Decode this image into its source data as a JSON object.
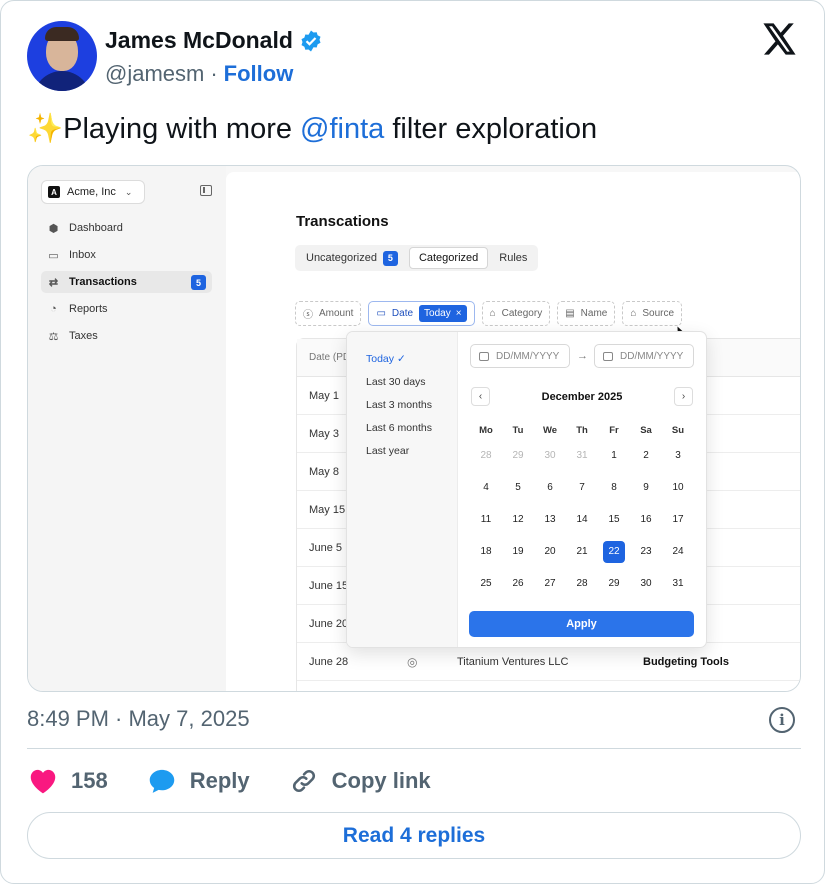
{
  "author": {
    "name": "James McDonald",
    "handle": "@jamesm",
    "separator": "·",
    "follow_label": "Follow"
  },
  "tweet": {
    "emoji": "✨",
    "text_before": "Playing with more ",
    "mention": "@finta",
    "text_after": " filter exploration"
  },
  "app": {
    "org_badge": "A",
    "org_name": "Acme, Inc",
    "nav": [
      {
        "icon": "⬢",
        "label": "Dashboard"
      },
      {
        "icon": "▭",
        "label": "Inbox"
      },
      {
        "icon": "⇄",
        "label": "Transactions",
        "badge": "5"
      },
      {
        "icon": "◔",
        "label": "Reports"
      },
      {
        "icon": "⚖",
        "label": "Taxes"
      }
    ],
    "page_title": "Transcations",
    "tabs": [
      {
        "label": "Uncategorized",
        "badge": "5"
      },
      {
        "label": "Categorized"
      },
      {
        "label": "Rules"
      }
    ],
    "filters": {
      "amount": "Amount",
      "date": "Date",
      "date_value": "Today",
      "category": "Category",
      "name": "Name",
      "source": "Source"
    },
    "table": {
      "date_header": "Date (PDT)",
      "rows": [
        {
          "date": "May 1"
        },
        {
          "date": "May 3"
        },
        {
          "date": "May 8"
        },
        {
          "date": "May 15"
        },
        {
          "date": "June 5"
        },
        {
          "date": "June 15"
        },
        {
          "date": "June 20"
        },
        {
          "date": "June 28",
          "merchant": "Titanium Ventures LLC",
          "category": "Budgeting Tools"
        }
      ]
    },
    "date_picker": {
      "presets": [
        "Today",
        "Last 30 days",
        "Last 3 months",
        "Last 6 months",
        "Last year"
      ],
      "selected_preset_check": "✓",
      "from_placeholder": "DD/MM/YYYY",
      "to_placeholder": "DD/MM/YYYY",
      "month_label": "December 2025",
      "weekdays": [
        "Mo",
        "Tu",
        "We",
        "Th",
        "Fr",
        "Sa",
        "Su"
      ],
      "weeks": [
        [
          "28",
          "29",
          "30",
          "31",
          "1",
          "2",
          "3"
        ],
        [
          "4",
          "5",
          "6",
          "7",
          "8",
          "9",
          "10"
        ],
        [
          "11",
          "12",
          "13",
          "14",
          "15",
          "16",
          "17"
        ],
        [
          "18",
          "19",
          "20",
          "21",
          "22",
          "23",
          "24"
        ],
        [
          "25",
          "26",
          "27",
          "28",
          "29",
          "30",
          "31"
        ]
      ],
      "muted_days_first_row": 4,
      "selected_day": "22",
      "apply_label": "Apply"
    }
  },
  "meta": {
    "timestamp": "8:49 PM · May 7, 2025"
  },
  "actions": {
    "like_count": "158",
    "reply_label": "Reply",
    "copy_label": "Copy link",
    "read_replies_label": "Read 4 replies"
  },
  "colors": {
    "link_blue": "#1d6ed8",
    "app_accent": "#1e64e0",
    "heart": "#f91880"
  }
}
